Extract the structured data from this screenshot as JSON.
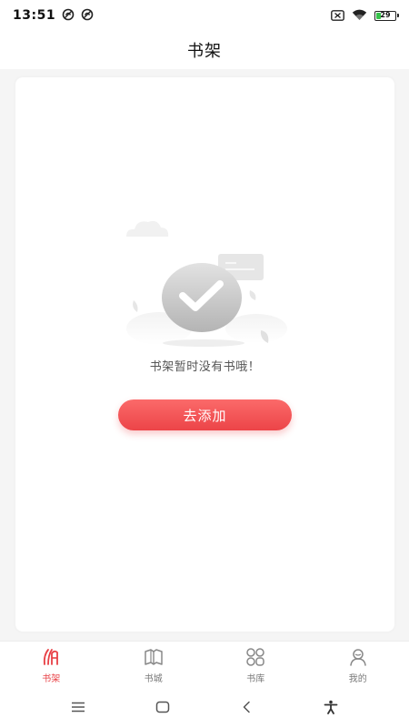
{
  "status_bar": {
    "time": "13:51",
    "battery_level": "29",
    "icons": [
      "notification-icon",
      "notification-icon",
      "sim-icon",
      "wifi-icon",
      "battery-icon"
    ]
  },
  "header": {
    "title": "书架"
  },
  "empty_state": {
    "message": "书架暂时没有书哦！",
    "button_label": "去添加"
  },
  "tabs": [
    {
      "label": "书架",
      "icon": "bookshelf-icon",
      "active": true
    },
    {
      "label": "书城",
      "icon": "book-store-icon",
      "active": false
    },
    {
      "label": "书库",
      "icon": "library-icon",
      "active": false
    },
    {
      "label": "我的",
      "icon": "profile-icon",
      "active": false
    }
  ],
  "nav_bar": {
    "icons": [
      "menu-icon",
      "home-icon",
      "back-icon",
      "accessibility-icon"
    ]
  },
  "colors": {
    "accent": "#e84045",
    "background": "#f5f5f5",
    "card": "#ffffff"
  }
}
